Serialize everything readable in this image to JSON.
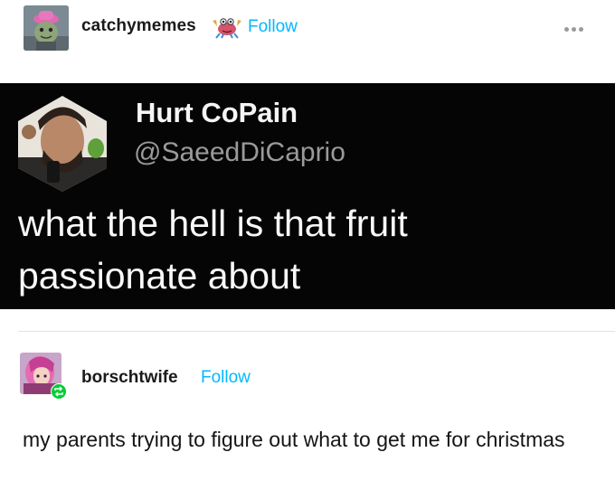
{
  "post": {
    "username": "catchymemes",
    "follow_label": "Follow",
    "badge_icon": "crab-emoji-icon",
    "more_icon": "ellipsis-icon",
    "accent_color": "#00b8ff"
  },
  "tweet": {
    "display_name": "Hurt CoPain",
    "handle": "@SaeedDiCaprio",
    "text": "what the hell is that fruit passionate about"
  },
  "reblog": {
    "username": "borschtwife",
    "follow_label": "Follow",
    "reblog_badge_icon": "reblog-icon",
    "text": "my parents trying to figure out what to get me for christmas"
  }
}
